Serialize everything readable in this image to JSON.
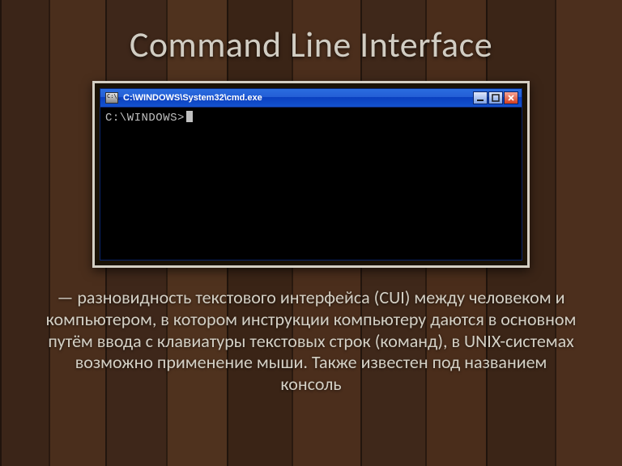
{
  "slide": {
    "title": "Command Line Interface",
    "body_text": " — разновидность текстового интерфейса (CUI) между человеком и компьютером, в котором инструкции компьютеру даются в основном путём ввода с клавиатуры текстовых строк (команд), в UNIX-системах возможно применение мыши. Также известен под названием консоль"
  },
  "cmd_window": {
    "title": "C:\\WINDOWS\\System32\\cmd.exe",
    "prompt": "C:\\WINDOWS>",
    "icon_name": "cmd-icon",
    "buttons": {
      "minimize": "minimize-icon",
      "maximize": "maximize-icon",
      "close": "close-icon"
    }
  },
  "colors": {
    "slide_text": "#d4d0c5",
    "titlebar_gradient_start": "#2a6de0",
    "titlebar_gradient_end": "#1453cf",
    "cmd_background": "#000000",
    "cmd_text": "#c0c0c0"
  }
}
